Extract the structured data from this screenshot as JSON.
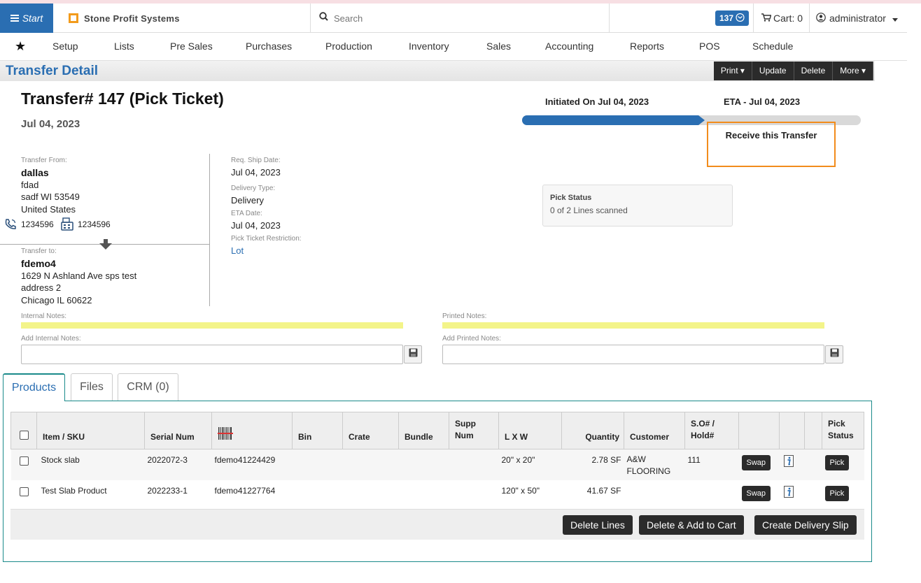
{
  "topbar": {
    "start_label": "Start",
    "brand": "Stone Profit Systems",
    "search_placeholder": "Search",
    "notification_count": "137",
    "cart_label": "Cart: 0",
    "user": "administrator"
  },
  "nav": [
    "Setup",
    "Lists",
    "Pre Sales",
    "Purchases",
    "Production",
    "Inventory",
    "Sales",
    "Accounting",
    "Reports",
    "POS",
    "Schedule"
  ],
  "page": {
    "title": "Transfer Detail",
    "actions": {
      "print": "Print",
      "update": "Update",
      "delete": "Delete",
      "more": "More"
    }
  },
  "transfer": {
    "heading": "Transfer# 147 (Pick Ticket)",
    "date": "Jul 04, 2023",
    "initiated": "Initiated On Jul 04, 2023",
    "eta_label": "ETA - Jul 04, 2023",
    "progress_percent": 52,
    "receive_label": "Receive this Transfer"
  },
  "from": {
    "label": "Transfer From:",
    "name": "dallas",
    "line1": "fdad",
    "line2": "sadf WI 53549",
    "line3": "United States",
    "phone": "1234596",
    "fax": "1234596"
  },
  "to": {
    "label": "Transfer to:",
    "name": "fdemo4",
    "line1": "1629 N Ashland Ave sps test",
    "line2": "address 2",
    "line3": "Chicago IL 60622"
  },
  "details": {
    "req_ship_label": "Req. Ship Date:",
    "req_ship": "Jul 04, 2023",
    "delivery_type_label": "Delivery Type:",
    "delivery_type": "Delivery",
    "eta_date_label": "ETA Date:",
    "eta_date": "Jul 04, 2023",
    "restriction_label": "Pick Ticket Restriction:",
    "restriction": "Lot"
  },
  "pick_status": {
    "label": "Pick Status",
    "value": "0 of 2 Lines scanned"
  },
  "notes": {
    "internal_label": "Internal Notes:",
    "printed_label": "Printed Notes:",
    "add_internal_label": "Add Internal Notes:",
    "add_printed_label": "Add Printed Notes:"
  },
  "tabs": [
    "Products",
    "Files",
    "CRM (0)"
  ],
  "table": {
    "headers": {
      "item": "Item / SKU",
      "serial": "Serial Num",
      "bin": "Bin",
      "crate": "Crate",
      "bundle": "Bundle",
      "supp1": "Supp",
      "supp2": "Num",
      "lxw": "L X W",
      "qty": "Quantity",
      "customer": "Customer",
      "so1": "S.O# /",
      "so2": "Hold#",
      "pick1": "Pick",
      "pick2": "Status"
    },
    "rows": [
      {
        "item": "Stock slab",
        "serial": "2022072-3",
        "barcode": "fdemo41224429",
        "lxw": "20\" x 20\"",
        "qty": "2.78 SF",
        "customer1": "A&W",
        "customer2": "FLOORING",
        "so": "111",
        "swap": "Swap",
        "pick": "Pick"
      },
      {
        "item": "Test Slab Product",
        "serial": "2022233-1",
        "barcode": "fdemo41227764",
        "lxw": "120\" x 50\"",
        "qty": "41.67 SF",
        "customer1": "",
        "customer2": "",
        "so": "",
        "swap": "Swap",
        "pick": "Pick"
      }
    ]
  },
  "footer": {
    "delete_lines": "Delete Lines",
    "delete_add_cart": "Delete & Add to Cart",
    "create_slip": "Create Delivery Slip"
  }
}
